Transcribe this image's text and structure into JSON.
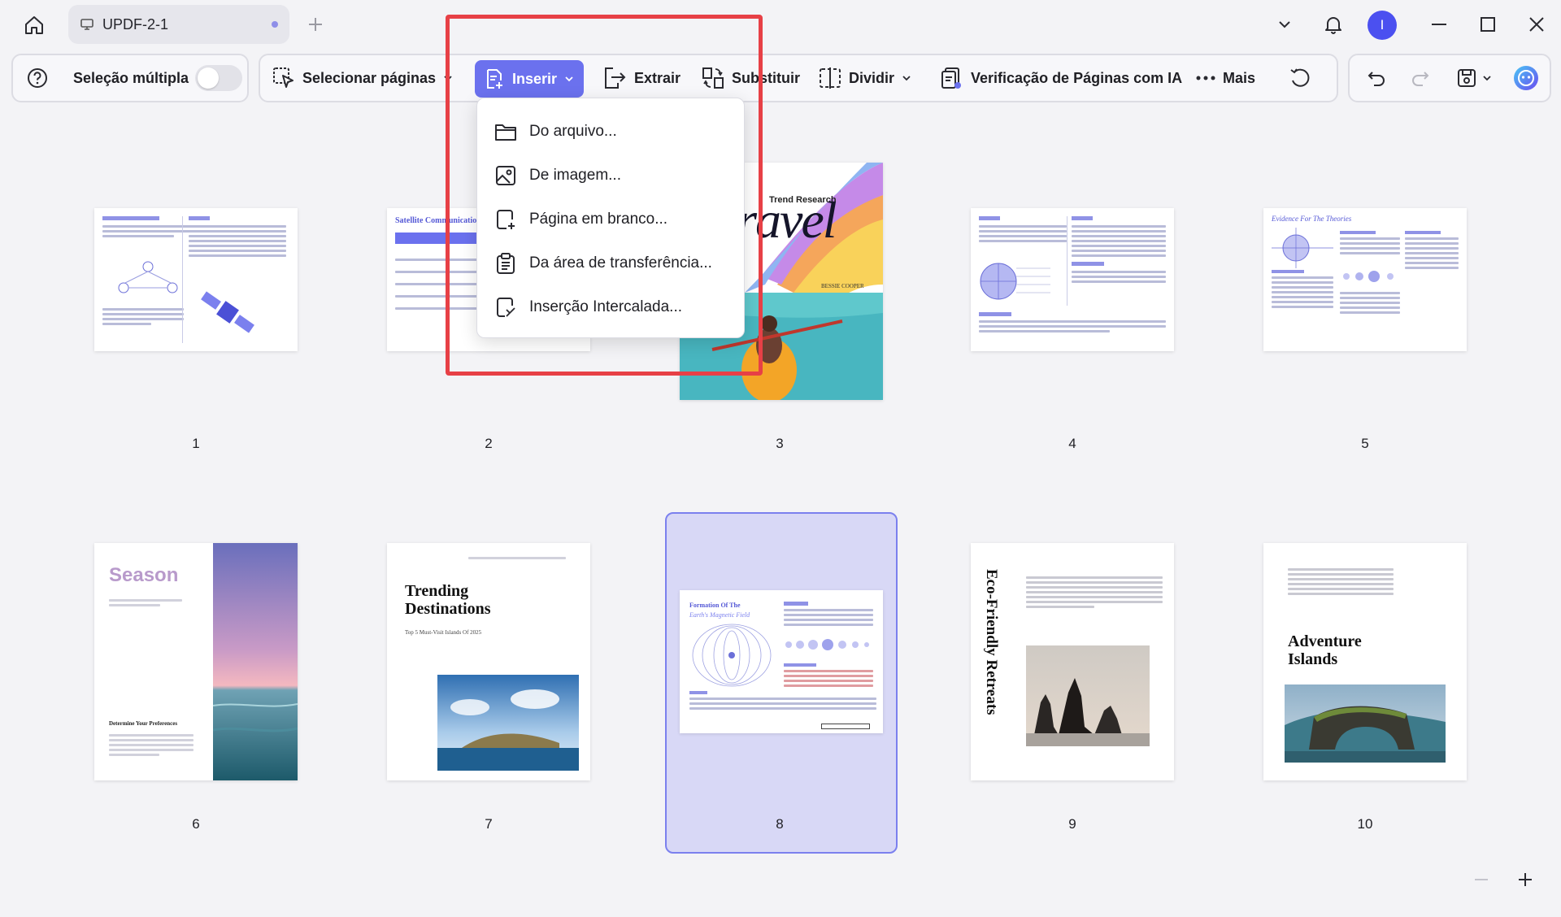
{
  "app": {
    "tab_title": "UPDF-2-1",
    "avatar_initial": "I"
  },
  "toolbar": {
    "multi_select_label": "Seleção múltipla",
    "select_pages_label": "Selecionar páginas",
    "insert_label": "Inserir",
    "extract_label": "Extrair",
    "replace_label": "Substituir",
    "split_label": "Dividir",
    "ai_check_label": "Verificação de Páginas com IA",
    "more_label": "Mais"
  },
  "insert_menu": {
    "items": [
      {
        "label": "Do arquivo...",
        "icon": "folder-icon"
      },
      {
        "label": "De imagem...",
        "icon": "image-icon"
      },
      {
        "label": "Página em branco...",
        "icon": "blank-page-icon"
      },
      {
        "label": "Da área de transferência...",
        "icon": "clipboard-icon"
      },
      {
        "label": "Inserção Intercalada...",
        "icon": "interleave-icon"
      }
    ]
  },
  "pages": [
    {
      "number": "1",
      "heading": ""
    },
    {
      "number": "2",
      "heading": "Satellite Communication"
    },
    {
      "number": "3",
      "heading": "Travel",
      "subtitle": "Trend Research",
      "author": "BESSIE COOPER"
    },
    {
      "number": "4",
      "heading": ""
    },
    {
      "number": "5",
      "heading": "Evidence For The Theories"
    },
    {
      "number": "6",
      "heading": "Season",
      "subtitle": "Determine Your Preferences"
    },
    {
      "number": "7",
      "heading": "Trending Destinations",
      "subtitle": "Top 5 Must-Visit Islands Of 2025"
    },
    {
      "number": "8",
      "heading": "Formation Of The",
      "subtitle": "Earth's Magnetic Field"
    },
    {
      "number": "9",
      "heading": "Eco-Friendly Retreats"
    },
    {
      "number": "10",
      "heading": "Adventure Islands"
    }
  ],
  "selected_page": "8",
  "colors": {
    "accent": "#6b71ee",
    "highlight": "#e74046",
    "selection_bg": "#d8d8f6"
  }
}
